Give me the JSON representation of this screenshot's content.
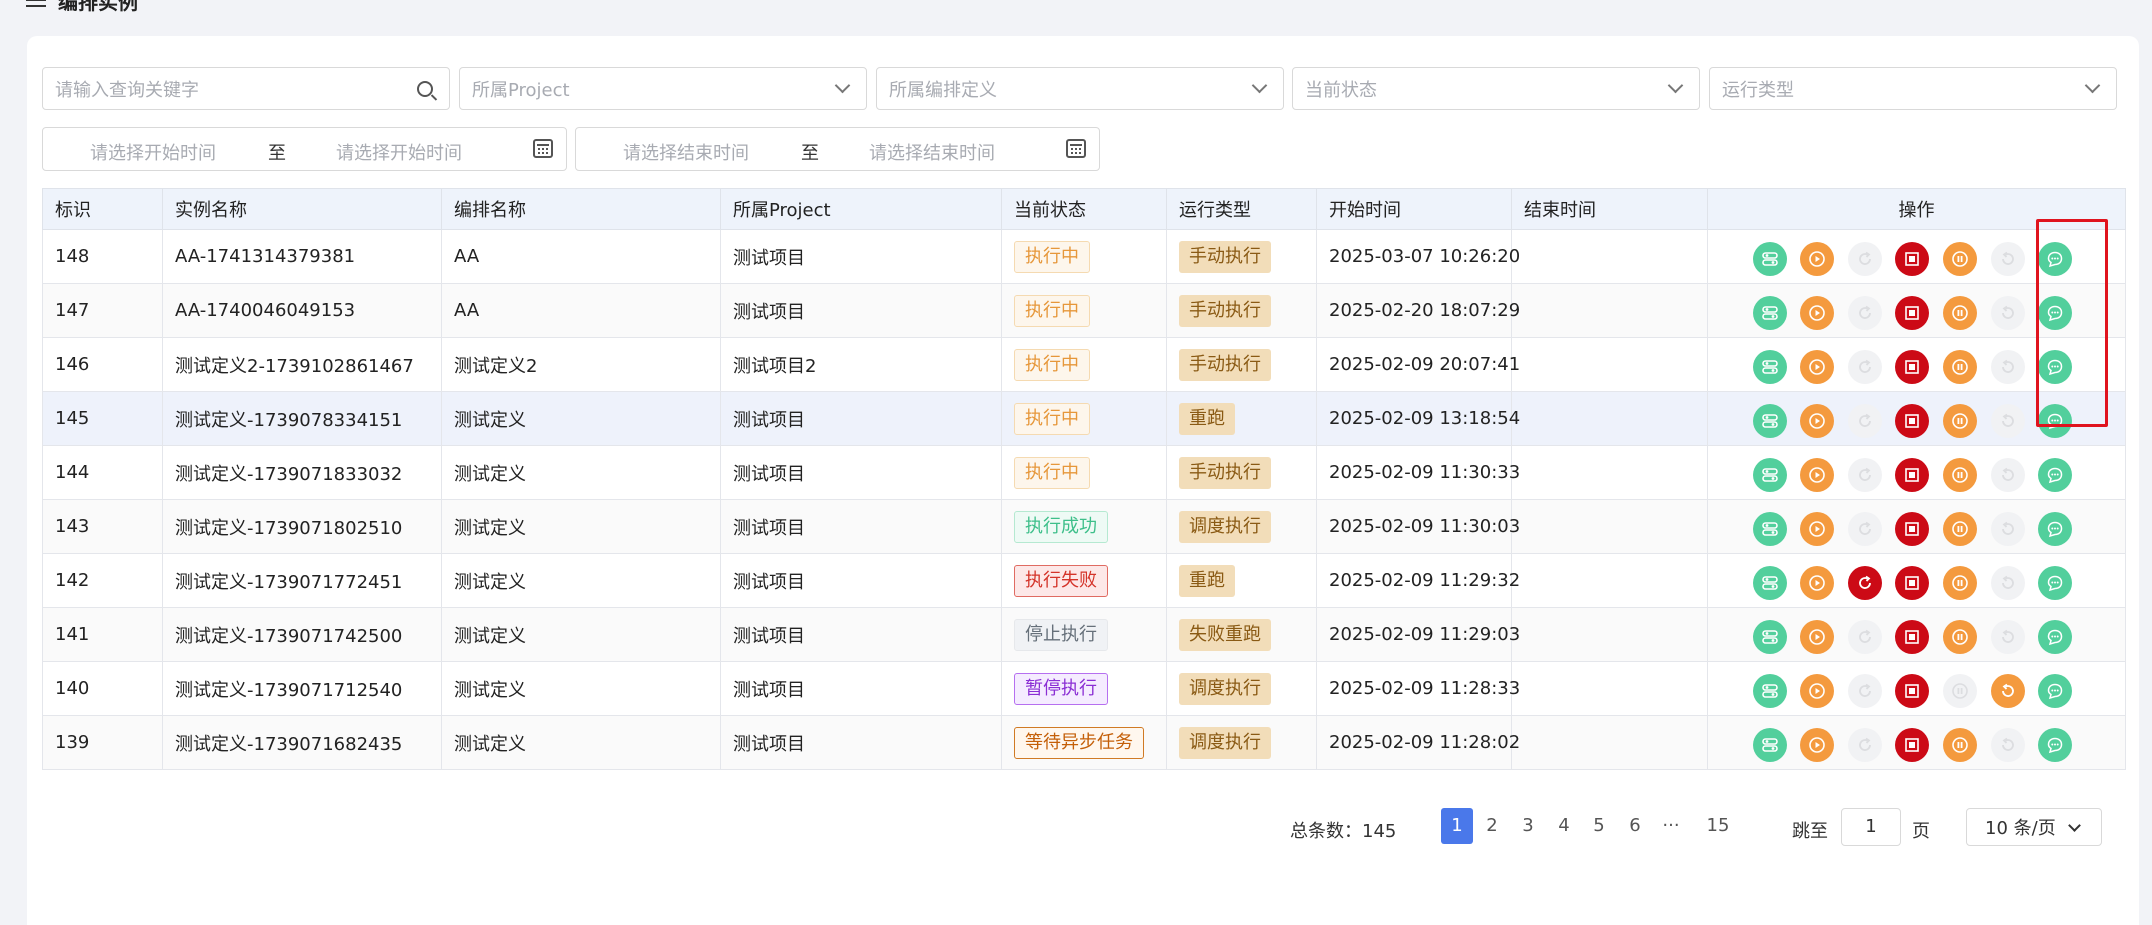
{
  "page": {
    "title": "编排实例"
  },
  "filters": {
    "keyword_placeholder": "请输入查询关键字",
    "project_placeholder": "所属Project",
    "definition_placeholder": "所属编排定义",
    "status_placeholder": "当前状态",
    "run_type_placeholder": "运行类型",
    "start_range": {
      "from_placeholder": "请选择开始时间",
      "separator": "至",
      "to_placeholder": "请选择开始时间"
    },
    "end_range": {
      "from_placeholder": "请选择结束时间",
      "separator": "至",
      "to_placeholder": "请选择结束时间"
    }
  },
  "table": {
    "headers": [
      "标识",
      "实例名称",
      "编排名称",
      "所属Project",
      "当前状态",
      "运行类型",
      "开始时间",
      "结束时间",
      "操作"
    ],
    "rows": [
      {
        "id": "148",
        "name": "AA-1741314379381",
        "orch": "AA",
        "project": "测试项目",
        "status": "执行中",
        "status_kind": "running",
        "run_type": "手动执行",
        "start": "2025-03-07 10:26:20",
        "end": "",
        "ops": [
          "green",
          "orange",
          "gray",
          "red",
          "orange",
          "gray",
          "green"
        ]
      },
      {
        "id": "147",
        "name": "AA-1740046049153",
        "orch": "AA",
        "project": "测试项目",
        "status": "执行中",
        "status_kind": "running",
        "run_type": "手动执行",
        "start": "2025-02-20 18:07:29",
        "end": "",
        "ops": [
          "green",
          "orange",
          "gray",
          "red",
          "orange",
          "gray",
          "green"
        ]
      },
      {
        "id": "146",
        "name": "测试定义2-1739102861467",
        "orch": "测试定义2",
        "project": "测试项目2",
        "status": "执行中",
        "status_kind": "running",
        "run_type": "手动执行",
        "start": "2025-02-09 20:07:41",
        "end": "",
        "ops": [
          "green",
          "orange",
          "gray",
          "red",
          "orange",
          "gray",
          "green"
        ]
      },
      {
        "id": "145",
        "name": "测试定义-1739078334151",
        "orch": "测试定义",
        "project": "测试项目",
        "status": "执行中",
        "status_kind": "running",
        "run_type": "重跑",
        "start": "2025-02-09 13:18:54",
        "end": "",
        "ops": [
          "green",
          "orange",
          "gray",
          "red",
          "orange",
          "gray",
          "green"
        ]
      },
      {
        "id": "144",
        "name": "测试定义-1739071833032",
        "orch": "测试定义",
        "project": "测试项目",
        "status": "执行中",
        "status_kind": "running",
        "run_type": "手动执行",
        "start": "2025-02-09 11:30:33",
        "end": "",
        "ops": [
          "green",
          "orange",
          "gray",
          "red",
          "orange",
          "gray",
          "green"
        ]
      },
      {
        "id": "143",
        "name": "测试定义-1739071802510",
        "orch": "测试定义",
        "project": "测试项目",
        "status": "执行成功",
        "status_kind": "success",
        "run_type": "调度执行",
        "start": "2025-02-09 11:30:03",
        "end": "",
        "ops": [
          "green",
          "orange",
          "gray",
          "red",
          "orange",
          "gray",
          "green"
        ]
      },
      {
        "id": "142",
        "name": "测试定义-1739071772451",
        "orch": "测试定义",
        "project": "测试项目",
        "status": "执行失败",
        "status_kind": "fail",
        "run_type": "重跑",
        "start": "2025-02-09 11:29:32",
        "end": "",
        "ops": [
          "green",
          "orange",
          "red-rerun",
          "red",
          "orange",
          "gray",
          "green"
        ]
      },
      {
        "id": "141",
        "name": "测试定义-1739071742500",
        "orch": "测试定义",
        "project": "测试项目",
        "status": "停止执行",
        "status_kind": "stop",
        "run_type": "失败重跑",
        "start": "2025-02-09 11:29:03",
        "end": "",
        "ops": [
          "green",
          "orange",
          "gray",
          "red",
          "orange",
          "gray",
          "green"
        ]
      },
      {
        "id": "140",
        "name": "测试定义-1739071712540",
        "orch": "测试定义",
        "project": "测试项目",
        "status": "暂停执行",
        "status_kind": "pause",
        "run_type": "调度执行",
        "start": "2025-02-09 11:28:33",
        "end": "",
        "ops": [
          "green",
          "orange",
          "gray",
          "red",
          "gray",
          "orange",
          "green"
        ]
      },
      {
        "id": "139",
        "name": "测试定义-1739071682435",
        "orch": "测试定义",
        "project": "测试项目",
        "status": "等待异步任务",
        "status_kind": "wait",
        "run_type": "调度执行",
        "start": "2025-02-09 11:28:02",
        "end": "",
        "ops": [
          "green",
          "orange",
          "gray",
          "red",
          "orange",
          "gray",
          "green"
        ]
      }
    ]
  },
  "pagination": {
    "total_label": "总条数：",
    "total": "145",
    "pages": [
      "1",
      "2",
      "3",
      "4",
      "5",
      "6",
      "···",
      "15"
    ],
    "active_page": "1",
    "jump_label": "跳至",
    "jump_value": "1",
    "jump_suffix": "页",
    "page_size": "10 条/页"
  },
  "icons": {
    "title": "list-icon",
    "op_buttons": [
      "settings-icon",
      "play-icon",
      "rerun-icon",
      "stop-icon",
      "pause-icon",
      "resume-icon",
      "message-icon"
    ]
  },
  "colors": {
    "accent": "#4a78ea",
    "green_button": "#52cf9c",
    "orange_button": "#f49a3e",
    "red_button": "#cc0a16",
    "highlight_box": "#e0141e"
  }
}
